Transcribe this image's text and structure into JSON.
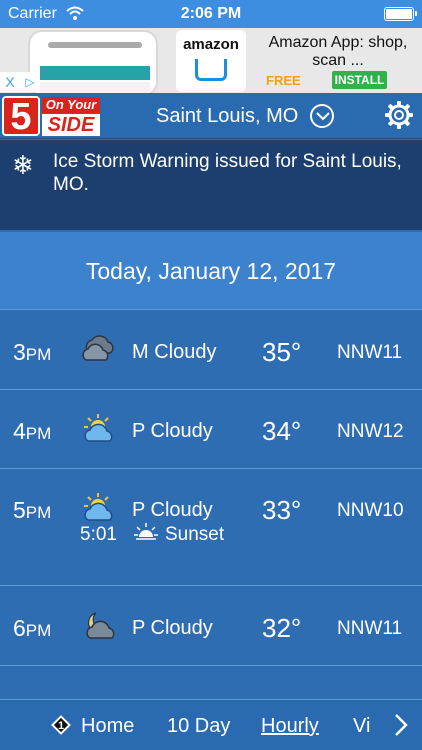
{
  "status_bar": {
    "carrier": "Carrier",
    "time": "2:06 PM"
  },
  "ad": {
    "brand": "amazon",
    "title": "Amazon App: shop, scan ...",
    "price": "FREE",
    "install_label": "INSTALL",
    "close_glyph": "X",
    "adchoices_glyph": "▷"
  },
  "header": {
    "logo_number": "5",
    "logo_top": "On Your",
    "logo_bottom": "SIDE",
    "location": "Saint Louis, MO"
  },
  "alert": {
    "icon": "snowflake-icon",
    "text": "Ice Storm Warning issued for Saint Louis, MO."
  },
  "date": "Today, January 12, 2017",
  "hours": [
    {
      "hour": "3",
      "ampm": "PM",
      "icon": "cloud-icon",
      "condition": "M Cloudy",
      "temp": "35°",
      "wind": "NNW11"
    },
    {
      "hour": "4",
      "ampm": "PM",
      "icon": "partly-cloudy-sun-icon",
      "condition": "P Cloudy",
      "temp": "34°",
      "wind": "NNW12"
    },
    {
      "hour": "5",
      "ampm": "PM",
      "icon": "partly-cloudy-sun-icon",
      "condition": "P Cloudy",
      "temp": "33°",
      "wind": "NNW10"
    },
    {
      "hour": "6",
      "ampm": "PM",
      "icon": "partly-cloudy-moon-icon",
      "condition": "P Cloudy",
      "temp": "32°",
      "wind": "NNW11"
    }
  ],
  "sunset": {
    "time": "5:01",
    "label": "Sunset"
  },
  "nav": {
    "badge": "1",
    "items": [
      {
        "label": "Home",
        "active": false
      },
      {
        "label": "10 Day",
        "active": false
      },
      {
        "label": "Hourly",
        "active": true
      },
      {
        "label": "Vi",
        "active": false
      }
    ]
  }
}
